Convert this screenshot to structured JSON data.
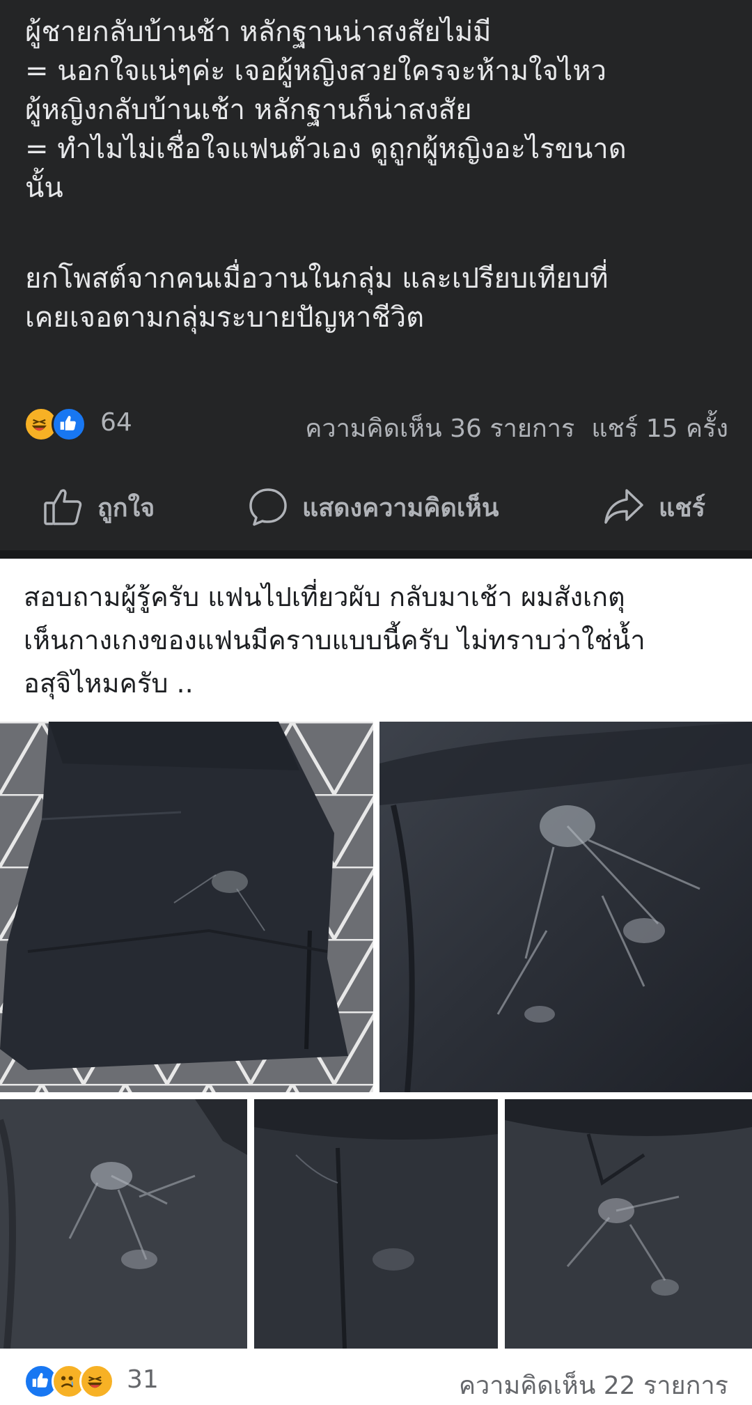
{
  "post": {
    "lines": [
      "ผู้ชายกลับบ้านช้า หลักฐานน่าสงสัยไม่มี",
      "= นอกใจแน่ๆค่ะ เจอผู้หญิงสวยใครจะห้ามใจไหว",
      "ผู้หญิงกลับบ้านเช้า หลักฐานก็น่าสงสัย",
      "= ทำไมไม่เชื่อใจแฟนตัวเอง ดูถูกผู้หญิงอะไรขนาด",
      "นั้น",
      "ยกโพสต์จากคนเมื่อวานในกลุ่ม และเปรียบเทียบที่",
      "เคยเจอตามกลุ่มระบายปัญหาชีวิต"
    ],
    "reaction_count": "64",
    "comments": "ความคิดเห็น 36 รายการ",
    "shares": "แชร์ 15 ครั้ง",
    "reaction_icons": [
      "haha-icon",
      "like-icon"
    ]
  },
  "actions": {
    "like": "ถูกใจ",
    "comment": "แสดงความคิดเห็น",
    "share": "แชร์"
  },
  "shared_post": {
    "lines": [
      "สอบถามผู้รู้ครับ แฟนไปเที่ยวผับ กลับมาเช้า ผมสังเกตุ",
      "เห็นกางเกงของแฟนมีคราบแบบนี้ครับ ไม่ทราบว่าใช่น้ำ",
      "อสุจิไหมครับ .."
    ],
    "photos": [
      "shorts-photo",
      "stain-closeup-photo",
      "stain-closeup-photo",
      "seam-closeup-photo",
      "stain-closeup-photo"
    ],
    "reaction_count": "31",
    "comments": "ความคิดเห็น 22 รายการ",
    "reaction_icons": [
      "like-icon",
      "sad-icon",
      "haha-icon"
    ]
  },
  "colors": {
    "dark_bg": "#242526",
    "fb_blue": "#1877f2",
    "haha_yellow": "#f7b125"
  }
}
